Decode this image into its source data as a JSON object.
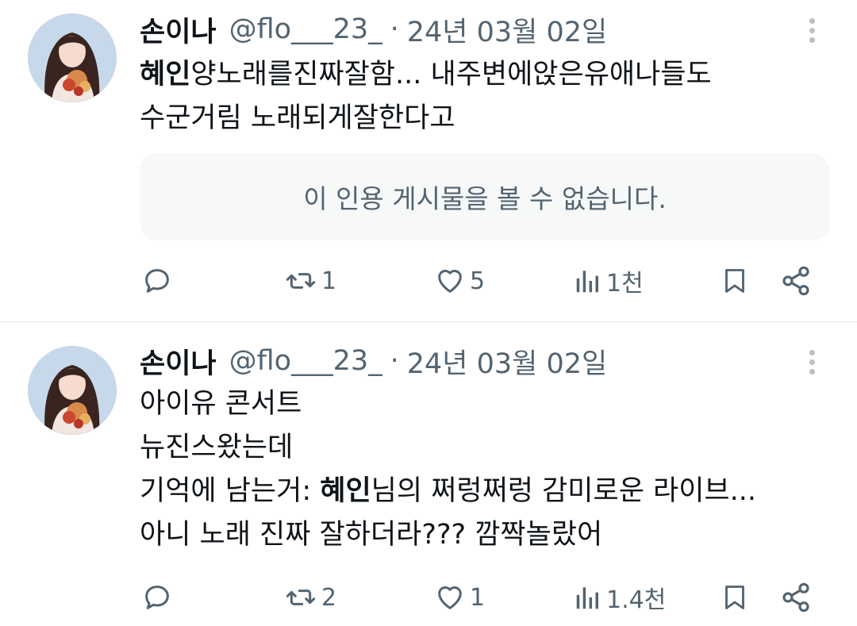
{
  "tweets": [
    {
      "author_name": "손이나",
      "handle": "@flo___23_",
      "separator": "·",
      "date": "24년 03월 02일",
      "mention": "혜인",
      "line1_rest": "양노래를진짜잘함... 내주변에앉은유애나들도",
      "line2": "수군거림 노래되게잘한다고",
      "quote_notice": "이 인용 게시물을 볼 수 없습니다.",
      "retweets": "1",
      "likes": "5",
      "views": "1천"
    },
    {
      "author_name": "손이나",
      "handle": "@flo___23_",
      "separator": "·",
      "date": "24년 03월 02일",
      "line1": "아이유 콘서트",
      "line2": "뉴진스왔는데",
      "line3_prefix": "기억에 남는거: ",
      "mention": "혜인",
      "line3_rest": "님의 쩌렁쩌렁 감미로운 라이브...",
      "line4": "아니 노래 진짜 잘하더라??? 깜짝놀랐어",
      "retweets": "2",
      "likes": "1",
      "views": "1.4천"
    }
  ],
  "icons": {
    "reply": "reply-icon",
    "retweet": "retweet-icon",
    "like": "heart-icon",
    "views": "bar-chart-icon",
    "bookmark": "bookmark-icon",
    "share": "share-icon",
    "more": "more-vertical-icon"
  },
  "colors": {
    "text": "#0f1419",
    "secondary": "#536471",
    "quote_bg": "#f7f9f9"
  }
}
